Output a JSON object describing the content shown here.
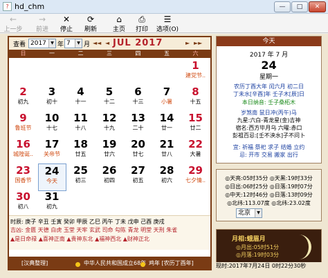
{
  "window": {
    "title": "hd_chm",
    "app_icon_glyph": "?",
    "minimize": "—",
    "maximize": "□",
    "close": "✕"
  },
  "toolbar": {
    "back": {
      "label": "上一步",
      "icon": "←"
    },
    "forward": {
      "label": "前进",
      "icon": "→"
    },
    "stop": {
      "label": "停止",
      "icon": "✕"
    },
    "refresh": {
      "label": "刷新",
      "icon": "⟳"
    },
    "home": {
      "label": "主页",
      "icon": "⌂"
    },
    "print": {
      "label": "打印",
      "icon": "⎙"
    },
    "options": {
      "label": "选项(O)",
      "icon": "☰"
    }
  },
  "calendar": {
    "view_label": "查看",
    "year_value": "2017",
    "year_unit": "年",
    "month_value": "7",
    "month_unit": "月",
    "prev_year": "◄◄",
    "prev_month": "◄",
    "month_title": "JUL 2017",
    "next_month": "►",
    "next_year": "►►",
    "weekdays": [
      "日",
      "一",
      "二",
      "三",
      "四",
      "五",
      "六"
    ],
    "weeks": [
      [
        {
          "n": "",
          "s": ""
        },
        {
          "n": "",
          "s": ""
        },
        {
          "n": "",
          "s": ""
        },
        {
          "n": "",
          "s": ""
        },
        {
          "n": "",
          "s": ""
        },
        {
          "n": "",
          "s": ""
        },
        {
          "n": "1",
          "s": "建党节..",
          "red": true,
          "fest": true
        }
      ],
      [
        {
          "n": "2",
          "s": "初九",
          "red": true
        },
        {
          "n": "3",
          "s": "初十"
        },
        {
          "n": "4",
          "s": "十一"
        },
        {
          "n": "5",
          "s": "十二"
        },
        {
          "n": "6",
          "s": "十三"
        },
        {
          "n": "7",
          "s": "小暑",
          "fest": true
        },
        {
          "n": "8",
          "s": "十五",
          "red": true
        }
      ],
      [
        {
          "n": "9",
          "s": "鲁班节",
          "red": true,
          "fest": true
        },
        {
          "n": "10",
          "s": "十七"
        },
        {
          "n": "11",
          "s": "十八"
        },
        {
          "n": "12",
          "s": "十九"
        },
        {
          "n": "13",
          "s": "二十"
        },
        {
          "n": "14",
          "s": "廿一"
        },
        {
          "n": "15",
          "s": "廿二",
          "red": true
        }
      ],
      [
        {
          "n": "16",
          "s": "城隍诞..",
          "red": true,
          "fest": true
        },
        {
          "n": "17",
          "s": "关帝节",
          "fest": true
        },
        {
          "n": "18",
          "s": "廿五"
        },
        {
          "n": "19",
          "s": "廿六"
        },
        {
          "n": "20",
          "s": "廿七"
        },
        {
          "n": "21",
          "s": "廿八"
        },
        {
          "n": "22",
          "s": "大暑",
          "red": true
        }
      ],
      [
        {
          "n": "23",
          "s": "国香节",
          "red": true,
          "fest": true
        },
        {
          "n": "24",
          "s": "今天",
          "today": true
        },
        {
          "n": "25",
          "s": "初三"
        },
        {
          "n": "26",
          "s": "初四"
        },
        {
          "n": "27",
          "s": "初五"
        },
        {
          "n": "28",
          "s": "初六"
        },
        {
          "n": "29",
          "s": "七夕情..",
          "red": true,
          "fest": true
        }
      ],
      [
        {
          "n": "30",
          "s": "初八",
          "red": true
        },
        {
          "n": "31",
          "s": "初九"
        },
        {
          "n": "",
          "s": ""
        },
        {
          "n": "",
          "s": ""
        },
        {
          "n": "",
          "s": ""
        },
        {
          "n": "",
          "s": ""
        },
        {
          "n": "",
          "s": ""
        }
      ]
    ],
    "hours_row1": "时辰: 庚子 辛丑 壬寅 癸卯 甲辰 乙巳 丙午 丁未 戊申 己酉 庚戌",
    "hours_row2": "吉凶: 金匮 天德 白虎 玉堂 天牢 玄武 司命 勾陈 青龙 明堂 天刑 朱雀",
    "hours_row3": "▲是日命禄 ▲喜神正南 ▲贵神东北 ▲福神西北 ▲财神正北",
    "footer_left": "[汉典整理]",
    "footer_mid": "中华人民共和国成立68年",
    "footer_right": "鸡年 [农历丁酉年]"
  },
  "today_panel": {
    "header": "今天",
    "date": "2017 年 7 月",
    "day": "24",
    "weekday": "星期一",
    "lunar": "农历丁酉大年 闰六月 初二日",
    "ganzhi": "丁未水[辛酉]年 壬子木[辰]日",
    "ganzhi2": "本日纳音: 壬子桑柘木",
    "zhishen": "岁煞南 鼠日冲(丙午)马",
    "star": "九星:六白-青龙星(金)吉神",
    "xiu": "宿名:西方毕月乌 六曜:赤口",
    "peng": "彭祖百忌:[壬不泱水]子不问卜",
    "yi": "宜: 祈福 祭祀 求子 结婚 立约",
    "ji": "忌: 开市 交易 搬家 出行",
    "sun": "◎天亮:05时35分  ◎天黑:19时33分",
    "rise": "◎日出:06时25分  ◎日落:19时07分",
    "zhong": "◎中天:12时46分  ◎日落:13时09分",
    "lat": "◎北纬:113.07度  ◎北纬:23.02度",
    "city": "北京",
    "moon_title": "月相:蛾眉月",
    "moon_rise": "◎月出:05时51分",
    "moon_set": "◎月落:19时03分",
    "status": "现时:2017年7月24日 0时22分30秒"
  }
}
